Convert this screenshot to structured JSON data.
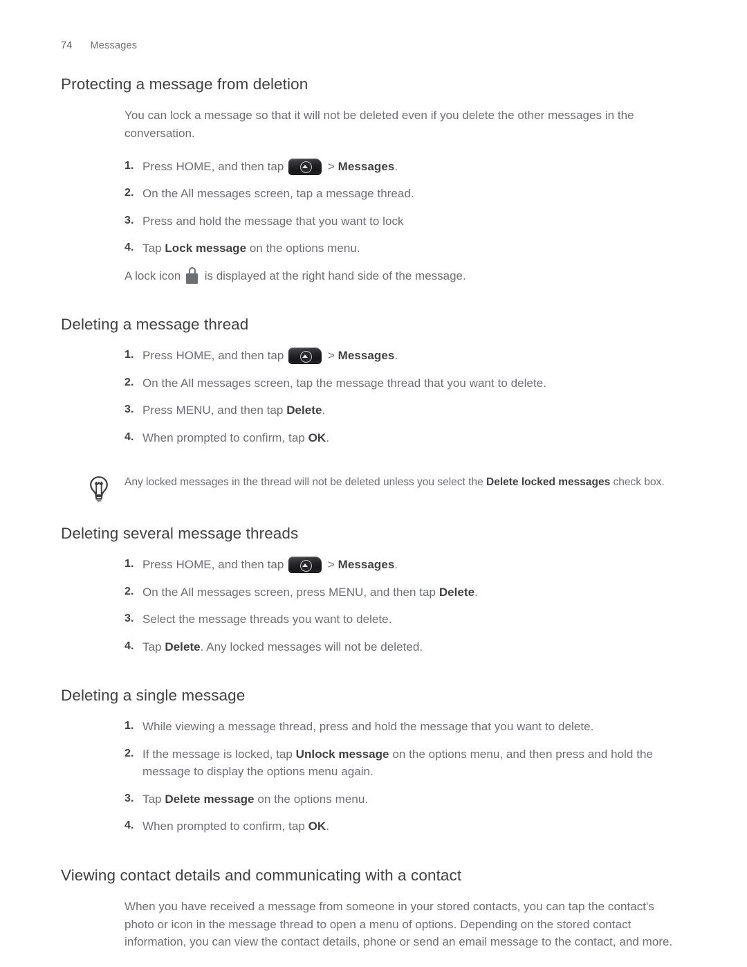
{
  "header": {
    "page_number": "74",
    "section": "Messages"
  },
  "icons": {
    "home_button": "home-apps-button-icon",
    "lock": "lock-icon",
    "tip_bulb": "lightbulb-icon"
  },
  "sections": [
    {
      "title": "Protecting a message from deletion",
      "intro": "You can lock a message so that it will not be deleted even if you delete the other messages in the conversation.",
      "steps": [
        {
          "num": "1.",
          "pre": "Press HOME, and then tap ",
          "icon": "home-button",
          "mid": " > ",
          "bold": "Messages",
          "post": "."
        },
        {
          "num": "2.",
          "pre": "On the All messages screen, tap a message thread."
        },
        {
          "num": "3.",
          "pre": "Press and hold the message that you want to lock"
        },
        {
          "num": "4.",
          "pre": "Tap ",
          "bold": "Lock message",
          "post": " on the options menu."
        }
      ],
      "after_note_pre": "A lock icon ",
      "after_note_post": " is displayed at the right hand side of the message."
    },
    {
      "title": "Deleting a message thread",
      "steps": [
        {
          "num": "1.",
          "pre": "Press HOME, and then tap ",
          "icon": "home-button",
          "mid": " > ",
          "bold": "Messages",
          "post": "."
        },
        {
          "num": "2.",
          "pre": "On the All messages screen, tap the message thread that you want to delete."
        },
        {
          "num": "3.",
          "pre": "Press MENU, and then tap ",
          "bold": "Delete",
          "post": "."
        },
        {
          "num": "4.",
          "pre": "When prompted to confirm, tap ",
          "bold": "OK",
          "post": "."
        }
      ]
    },
    {
      "title": "Deleting several message threads",
      "steps": [
        {
          "num": "1.",
          "pre": "Press HOME, and then tap ",
          "icon": "home-button",
          "mid": " > ",
          "bold": "Messages",
          "post": "."
        },
        {
          "num": "2.",
          "pre": "On the All messages screen, press MENU, and then tap ",
          "bold": "Delete",
          "post": "."
        },
        {
          "num": "3.",
          "pre": "Select the message threads you want to delete."
        },
        {
          "num": "4.",
          "pre": "Tap ",
          "bold": "Delete",
          "post": ". Any locked messages will not be deleted."
        }
      ]
    },
    {
      "title": "Deleting a single message",
      "steps": [
        {
          "num": "1.",
          "pre": "While viewing a message thread, press and hold the message that you want to delete."
        },
        {
          "num": "2.",
          "pre": "If the message is locked, tap ",
          "bold": "Unlock message",
          "post": " on the options menu, and then press and hold the message to display the options menu again."
        },
        {
          "num": "3.",
          "pre": "Tap ",
          "bold": "Delete message",
          "post": " on the options menu."
        },
        {
          "num": "4.",
          "pre": "When prompted to confirm, tap ",
          "bold": "OK",
          "post": "."
        }
      ]
    },
    {
      "title": "Viewing contact details and communicating with a contact",
      "intro": "When you have received a message from someone in your stored contacts, you can tap the contact's photo or icon in the message thread to open a menu of options. Depending on the stored contact information, you can view the contact details, phone or send an email message to the contact, and more."
    }
  ],
  "tip": {
    "pre": "Any locked messages in the thread will not be deleted unless you select the ",
    "bold": "Delete locked messages",
    "post": " check box."
  },
  "colors": {
    "body_text": "#6d6e71",
    "heading_text": "#414042",
    "page_bg": "#ffffff",
    "lock_gray": "#6d6e71"
  }
}
